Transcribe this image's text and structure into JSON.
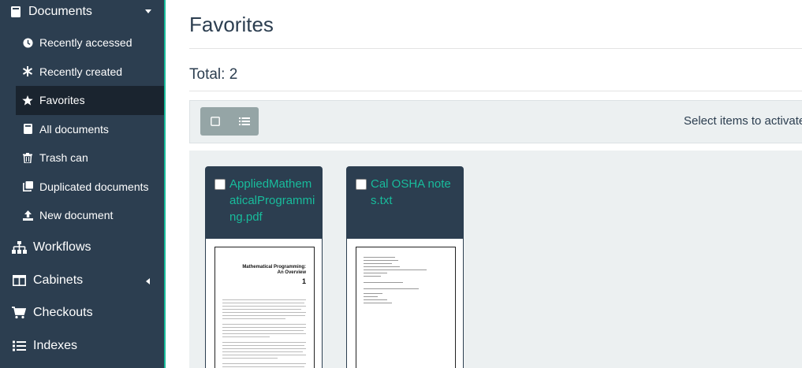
{
  "sidebar": {
    "documents_label": "Documents",
    "sub_items": [
      {
        "label": "Recently accessed",
        "icon": "clock-icon"
      },
      {
        "label": "Recently created",
        "icon": "asterisk-icon"
      },
      {
        "label": "Favorites",
        "icon": "star-icon",
        "active": true
      },
      {
        "label": "All documents",
        "icon": "book-icon"
      },
      {
        "label": "Trash can",
        "icon": "trash-icon"
      },
      {
        "label": "Duplicated documents",
        "icon": "clone-icon"
      },
      {
        "label": "New document",
        "icon": "upload-icon"
      }
    ],
    "main_items": [
      {
        "label": "Workflows",
        "icon": "sitemap-icon"
      },
      {
        "label": "Cabinets",
        "icon": "columns-icon"
      },
      {
        "label": "Checkouts",
        "icon": "cart-icon"
      },
      {
        "label": "Indexes",
        "icon": "list-icon"
      }
    ]
  },
  "main": {
    "title": "Favorites",
    "total": "Total: 2",
    "select_hint": "Select items to activate",
    "cards": [
      {
        "name": "AppliedMathematicalProgramming.pdf",
        "thumb_title": "Mathematical Programming:\nAn Overview",
        "thumb_number": "1"
      },
      {
        "name": "Cal OSHA notes.txt"
      }
    ]
  },
  "colors": {
    "sidebar_bg": "#2c3e50",
    "active_bg": "#1a242f",
    "accent": "#18bc9c",
    "toolbar_bg": "#ecf0f1",
    "button_bg": "#95a5a6"
  }
}
